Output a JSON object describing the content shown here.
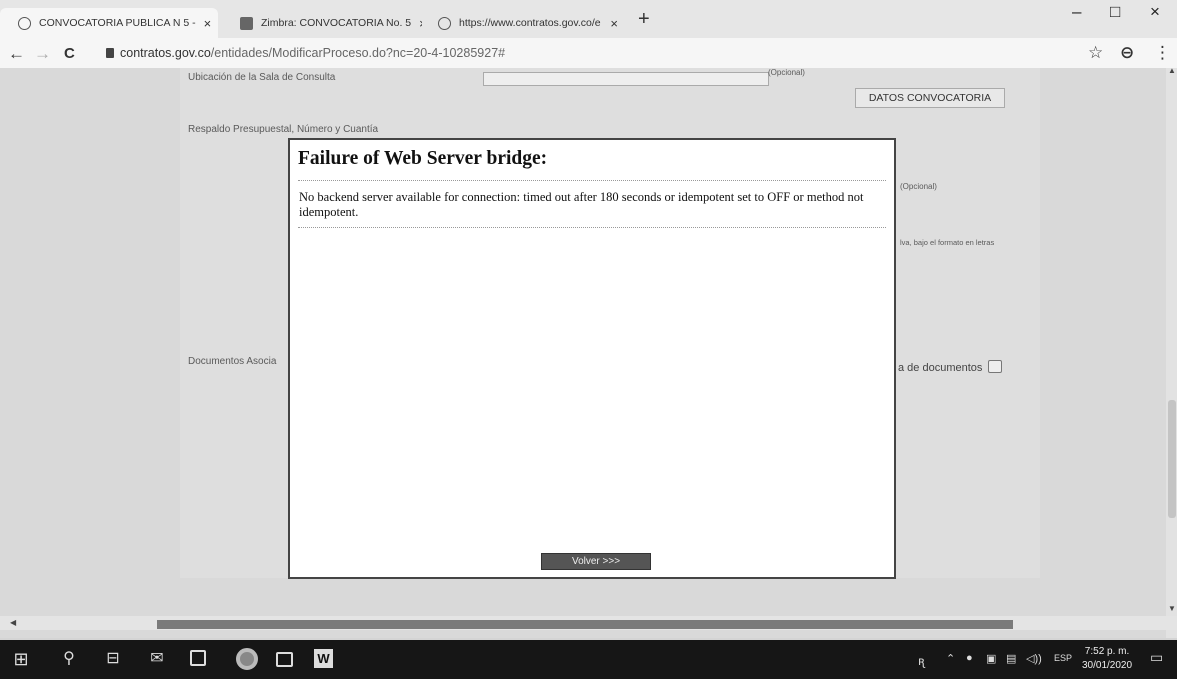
{
  "tabs": [
    {
      "title": "CONVOCATORIA PUBLICA N 5 - ",
      "close": "×",
      "favicon": "globe-icon"
    },
    {
      "title": "Zimbra: CONVOCATORIA No. 5 ",
      "close": "×",
      "favicon": "zimbra-icon"
    },
    {
      "title": "https://www.contratos.gov.co/e",
      "close": "×",
      "favicon": "globe-icon"
    }
  ],
  "newtab": "+",
  "window": {
    "minimize": "–",
    "maximize": "□",
    "close": "×"
  },
  "nav": {
    "back": "←",
    "forward": "→",
    "reload": "C"
  },
  "url": {
    "domain": "contratos.gov.co",
    "path": "/entidades/ModificarProceso.do?nc=20-4-10285927#"
  },
  "toolbar": {
    "star": "☆",
    "profile": "⊖",
    "menu": "⋮"
  },
  "form": {
    "ubicacion_label": "Ubicación de la Sala de Consulta",
    "opcional": "(Opcional)",
    "datos_button": "DATOS CONVOCATORIA",
    "respaldo_label": "Respaldo Presupuestal, Número y Cuantía",
    "docs_label": "Documentos Asocia",
    "side_text_1": "(Opcional)",
    "side_text_2": "lva, bajo el formato en letras",
    "docs_link": "a de documentos"
  },
  "modal": {
    "title": "Failure of Web Server bridge:",
    "message": "No backend server available for connection: timed out after 180 seconds or idempotent set to OFF or method not idempotent.",
    "button": "Volver >>>"
  },
  "taskbar": {
    "start": "⊞",
    "search": "⚲",
    "taskview": "⊟",
    "word": "W",
    "tray_icons": [
      "person-icon",
      "chevron-up-icon",
      "app-icon",
      "network-icon",
      "display-icon",
      "volume-icon"
    ],
    "lang": "ESP",
    "time": "7:52 p. m.",
    "date": "30/01/2020",
    "notif": "▭"
  }
}
